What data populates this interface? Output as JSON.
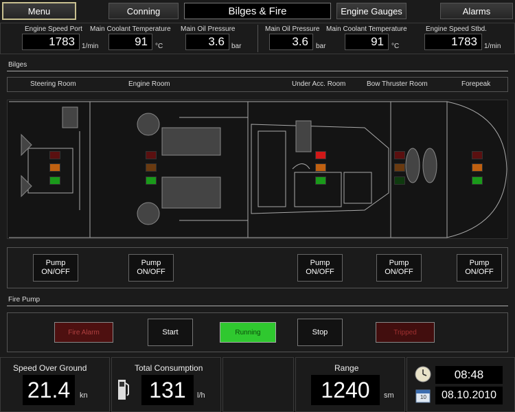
{
  "nav": {
    "menu": "Menu",
    "conning": "Conning",
    "title": "Bilges & Fire",
    "engine_gauges": "Engine Gauges",
    "alarms": "Alarms"
  },
  "gauges_port": [
    {
      "label": "Engine Speed Port",
      "value": "1783",
      "unit": "1/min"
    },
    {
      "label": "Main Coolant Temperature",
      "value": "91",
      "unit": "°C"
    },
    {
      "label": "Main Oil Pressure",
      "value": "3.6",
      "unit": "bar"
    }
  ],
  "gauges_stbd": [
    {
      "label": "Main Oil Pressure",
      "value": "3.6",
      "unit": "bar"
    },
    {
      "label": "Main Coolant Temperature",
      "value": "91",
      "unit": "°C"
    },
    {
      "label": "Engine Speed Stbd.",
      "value": "1783",
      "unit": "1/min"
    }
  ],
  "bilges": {
    "title": "Bilges",
    "rooms": [
      "Steering Room",
      "Engine Room",
      "Under Acc. Room",
      "Bow Thruster Room",
      "Forepeak"
    ],
    "pump_label_1": "Pump",
    "pump_label_2": "ON/OFF"
  },
  "fire_pump": {
    "title": "Fire Pump",
    "fire_alarm": "Fire Alarm",
    "start": "Start",
    "running": "Running",
    "stop": "Stop",
    "tripped": "Tripped"
  },
  "bottom": {
    "sog_label": "Speed Over Ground",
    "sog_value": "21.4",
    "sog_unit": "kn",
    "consumption_label": "Total Consumption",
    "consumption_value": "131",
    "consumption_unit": "l/h",
    "range_label": "Range",
    "range_value": "1240",
    "range_unit": "sm",
    "time": "08:48",
    "date": "08.10.2010",
    "calendar_day": "10"
  },
  "colors": {
    "alarm_red": "#5a0f0f",
    "running_green": "#2fd62f",
    "tripped_red": "#4a0f0f"
  }
}
